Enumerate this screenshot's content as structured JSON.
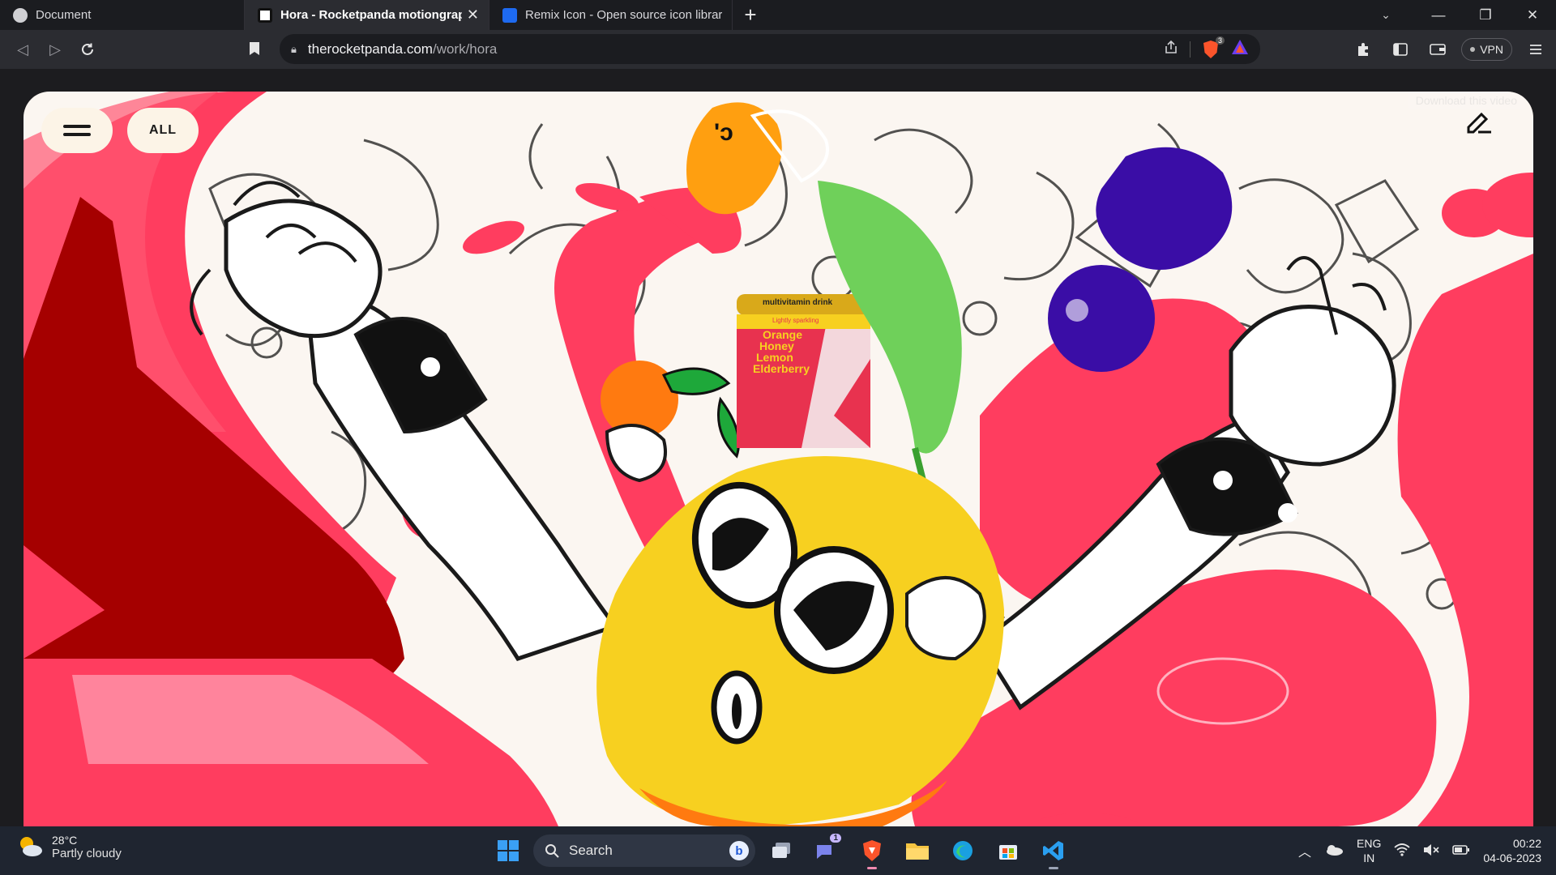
{
  "browser": {
    "tabs": [
      {
        "title": "Document",
        "active": false
      },
      {
        "title": "Hora - Rocketpanda motiongraphics",
        "active": true
      },
      {
        "title": "Remix Icon - Open source icon library",
        "active": false
      }
    ],
    "new_tab_label": "+",
    "url_host": "therocketpanda.com",
    "url_path": "/work/hora",
    "vpn_label": "VPN",
    "shields_badge": "3"
  },
  "page": {
    "menu_icon": "hamburger-icon",
    "filter_label": "ALL",
    "edit_icon": "pen-edit-icon",
    "download_overlay": "Download this video",
    "can": {
      "brand_line": "multivitamin drink",
      "subline": "Lightly sparkling",
      "flavors": [
        "Orange",
        "Honey",
        "Lemon",
        "Elderberry"
      ]
    },
    "colors": {
      "pink": "#ff3d5f",
      "dark_red": "#a50000",
      "lemon": "#f7d020",
      "orange": "#ff7a10",
      "purple": "#3a0da6",
      "leaf_green": "#6fd05a",
      "cream": "#fcf4e7"
    }
  },
  "taskbar": {
    "weather_temp": "28°C",
    "weather_condition": "Partly cloudy",
    "search_label": "Search",
    "chat_badge": "1",
    "language_line1": "ENG",
    "language_line2": "IN",
    "time": "00:22",
    "date": "04-06-2023"
  }
}
